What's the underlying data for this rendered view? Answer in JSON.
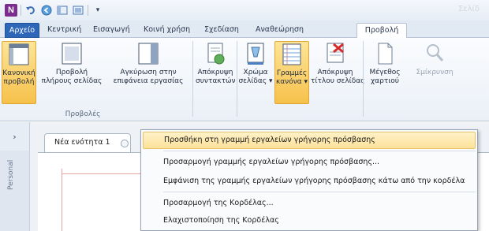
{
  "app": {
    "window_title": "Σελίδ"
  },
  "qat": {
    "icons": [
      "onenote-logo",
      "undo-icon",
      "back-icon",
      "dock-icon",
      "fullpage-icon",
      "customize-arrow-icon"
    ],
    "logo_letter": "N",
    "customize_glyph": "▾"
  },
  "tabs": [
    {
      "label": "Αρχείο"
    },
    {
      "label": "Κεντρική"
    },
    {
      "label": "Εισαγωγή"
    },
    {
      "label": "Κοινή χρήση"
    },
    {
      "label": "Σχεδίαση"
    },
    {
      "label": "Αναθεώρηση"
    },
    {
      "label": "Προβολή"
    }
  ],
  "ribbon": {
    "buttons": [
      {
        "line1": "Κανονική",
        "line2": "προβολή",
        "active": true
      },
      {
        "line1": "Προβολή",
        "line2": "πλήρους σελίδας"
      },
      {
        "line1": "Αγκύρωση στην",
        "line2": "επιφάνεια εργασίας"
      },
      {
        "line1": "Απόκρυψη",
        "line2": "συντακτών"
      },
      {
        "line1": "Χρώμα",
        "line2": "σελίδας ▾"
      },
      {
        "line1": "Γραμμές",
        "line2": "κανόνα ▾",
        "active": true
      },
      {
        "line1": "Απόκρυψη",
        "line2": "τίτλου σελίδας"
      },
      {
        "line1": "Μέγεθος",
        "line2": "χαρτιού"
      },
      {
        "line1": "Σμίκρυνση",
        "line2": "",
        "disabled": true
      }
    ],
    "group_labels": [
      "Προβολές"
    ]
  },
  "workspace": {
    "nav_glyph": "›",
    "section_tab": "Νέα ενότητα 1",
    "notebook_label": "Personal"
  },
  "context_menu": {
    "items": [
      {
        "label": "Προσθήκη στη γραμμή εργαλείων γρήγορης πρόσβασης",
        "highlighted": true
      },
      {
        "label": "Προσαρμογή γραμμής εργαλείων γρήγορης πρόσβασης..."
      },
      {
        "label": "Εμφάνιση της γραμμής εργαλείων γρήγορης πρόσβασης κάτω από την κορδέλα"
      },
      {
        "label": "Προσαρμογή της Κορδέλας..."
      },
      {
        "label": "Ελαχιστοποίηση της Κορδέλας"
      }
    ]
  },
  "colors": {
    "file_tab": "#2e67b7",
    "active_button": "#f6c14b",
    "highlight": "#fde19a",
    "onenote_brand": "#7a2c8f"
  }
}
